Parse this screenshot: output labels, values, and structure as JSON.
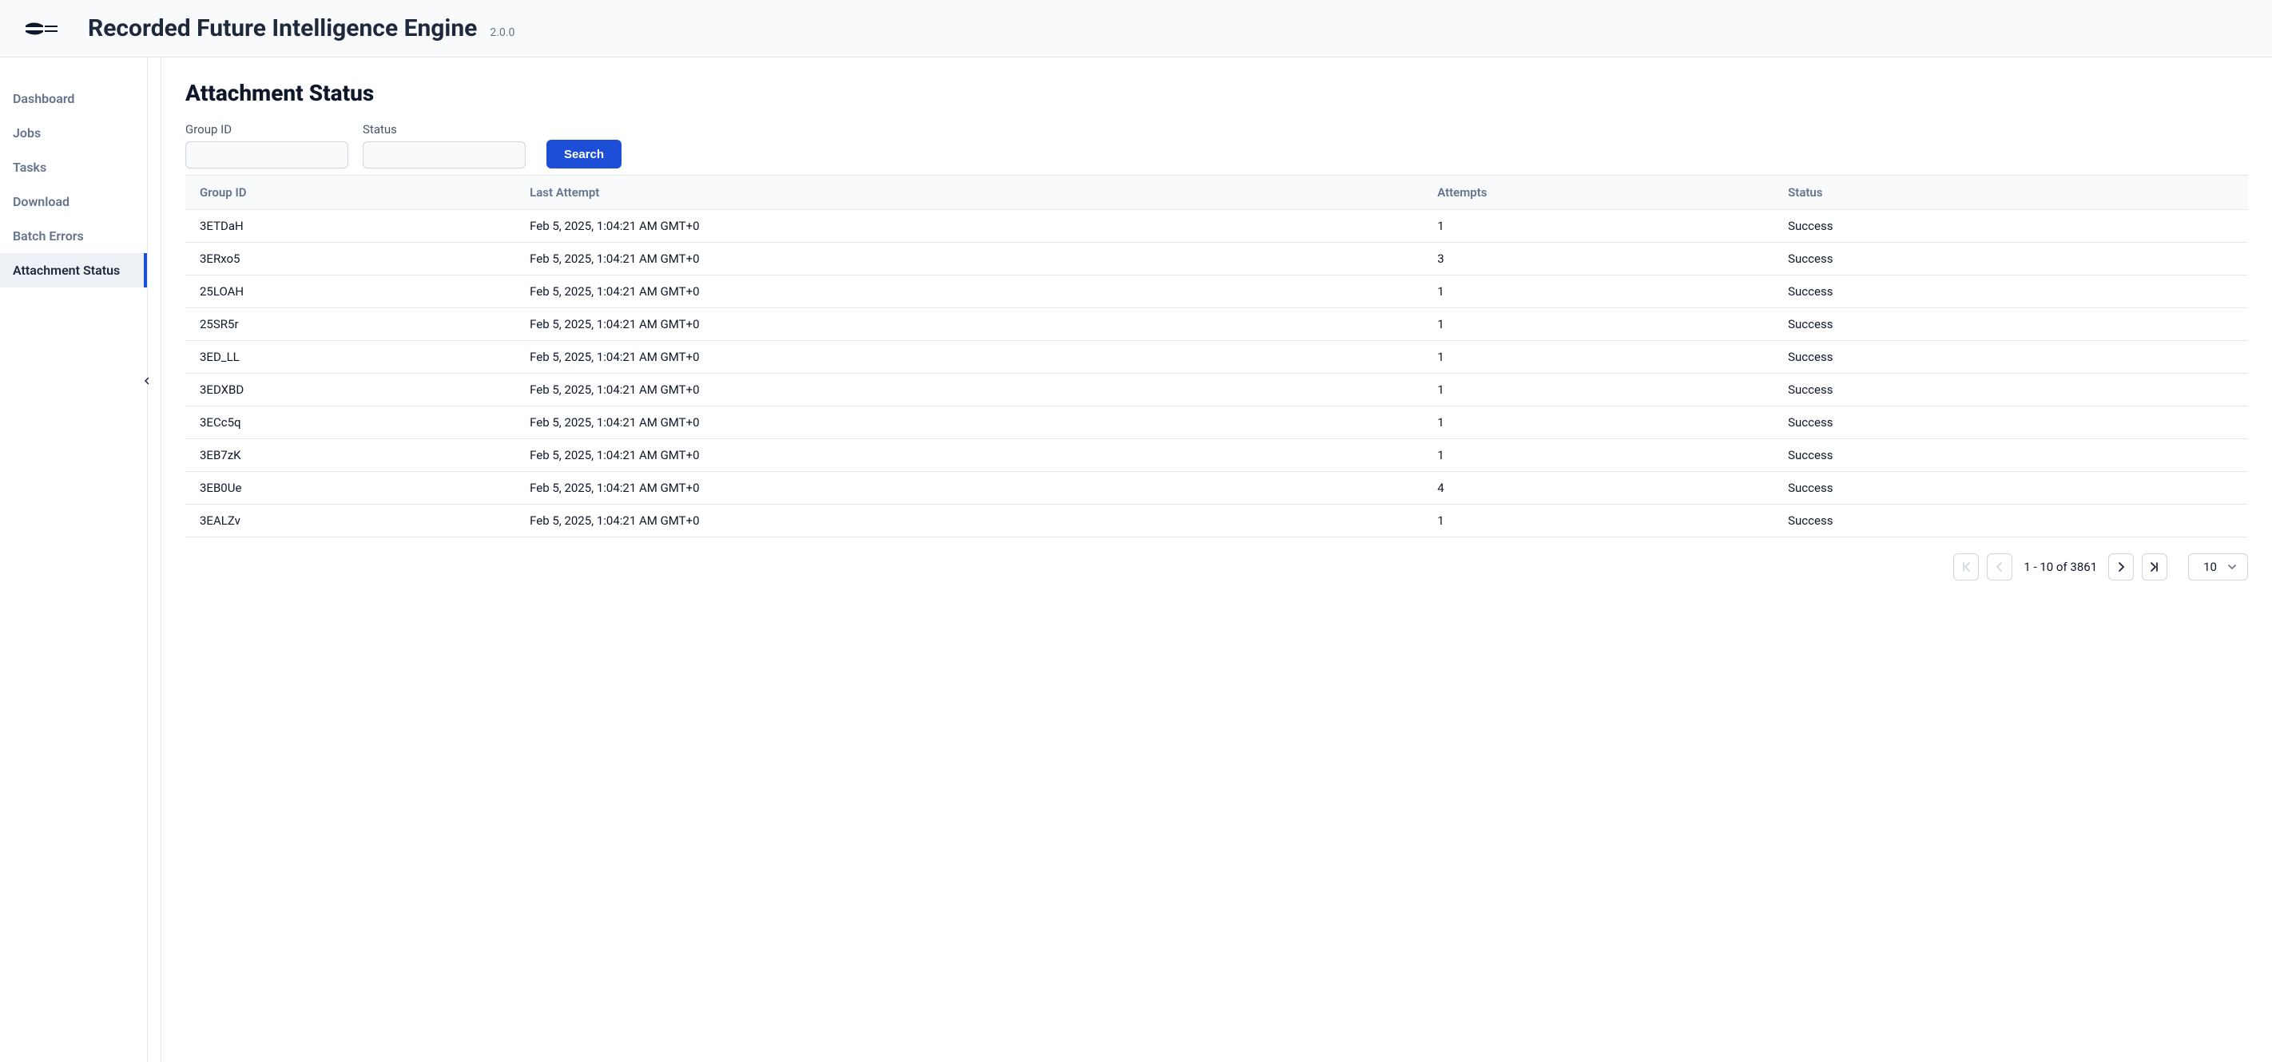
{
  "header": {
    "app_title": "Recorded Future Intelligence Engine",
    "version": "2.0.0"
  },
  "sidebar": {
    "items": [
      {
        "label": "Dashboard",
        "active": false
      },
      {
        "label": "Jobs",
        "active": false
      },
      {
        "label": "Tasks",
        "active": false
      },
      {
        "label": "Download",
        "active": false
      },
      {
        "label": "Batch Errors",
        "active": false
      },
      {
        "label": "Attachment Status",
        "active": true
      }
    ]
  },
  "page": {
    "title": "Attachment Status",
    "filters": {
      "group_id_label": "Group ID",
      "group_id_value": "",
      "status_label": "Status",
      "status_value": "",
      "search_label": "Search"
    },
    "table": {
      "columns": [
        "Group ID",
        "Last Attempt",
        "Attempts",
        "Status"
      ],
      "rows": [
        {
          "group_id": "3ETDaH",
          "last_attempt": "Feb 5, 2025, 1:04:21 AM GMT+0",
          "attempts": "1",
          "status": "Success"
        },
        {
          "group_id": "3ERxo5",
          "last_attempt": "Feb 5, 2025, 1:04:21 AM GMT+0",
          "attempts": "3",
          "status": "Success"
        },
        {
          "group_id": "25LOAH",
          "last_attempt": "Feb 5, 2025, 1:04:21 AM GMT+0",
          "attempts": "1",
          "status": "Success"
        },
        {
          "group_id": "25SR5r",
          "last_attempt": "Feb 5, 2025, 1:04:21 AM GMT+0",
          "attempts": "1",
          "status": "Success"
        },
        {
          "group_id": "3ED_LL",
          "last_attempt": "Feb 5, 2025, 1:04:21 AM GMT+0",
          "attempts": "1",
          "status": "Success"
        },
        {
          "group_id": "3EDXBD",
          "last_attempt": "Feb 5, 2025, 1:04:21 AM GMT+0",
          "attempts": "1",
          "status": "Success"
        },
        {
          "group_id": "3ECc5q",
          "last_attempt": "Feb 5, 2025, 1:04:21 AM GMT+0",
          "attempts": "1",
          "status": "Success"
        },
        {
          "group_id": "3EB7zK",
          "last_attempt": "Feb 5, 2025, 1:04:21 AM GMT+0",
          "attempts": "1",
          "status": "Success"
        },
        {
          "group_id": "3EB0Ue",
          "last_attempt": "Feb 5, 2025, 1:04:21 AM GMT+0",
          "attempts": "4",
          "status": "Success"
        },
        {
          "group_id": "3EALZv",
          "last_attempt": "Feb 5, 2025, 1:04:21 AM GMT+0",
          "attempts": "1",
          "status": "Success"
        }
      ]
    },
    "pagination": {
      "range_text": "1 - 10 of 3861",
      "page_size": "10"
    }
  },
  "colors": {
    "primary": "#1d4ed8",
    "text": "#0f172a",
    "muted": "#64748b",
    "border": "#e5e7eb",
    "row_hover": "#f8fafc"
  }
}
